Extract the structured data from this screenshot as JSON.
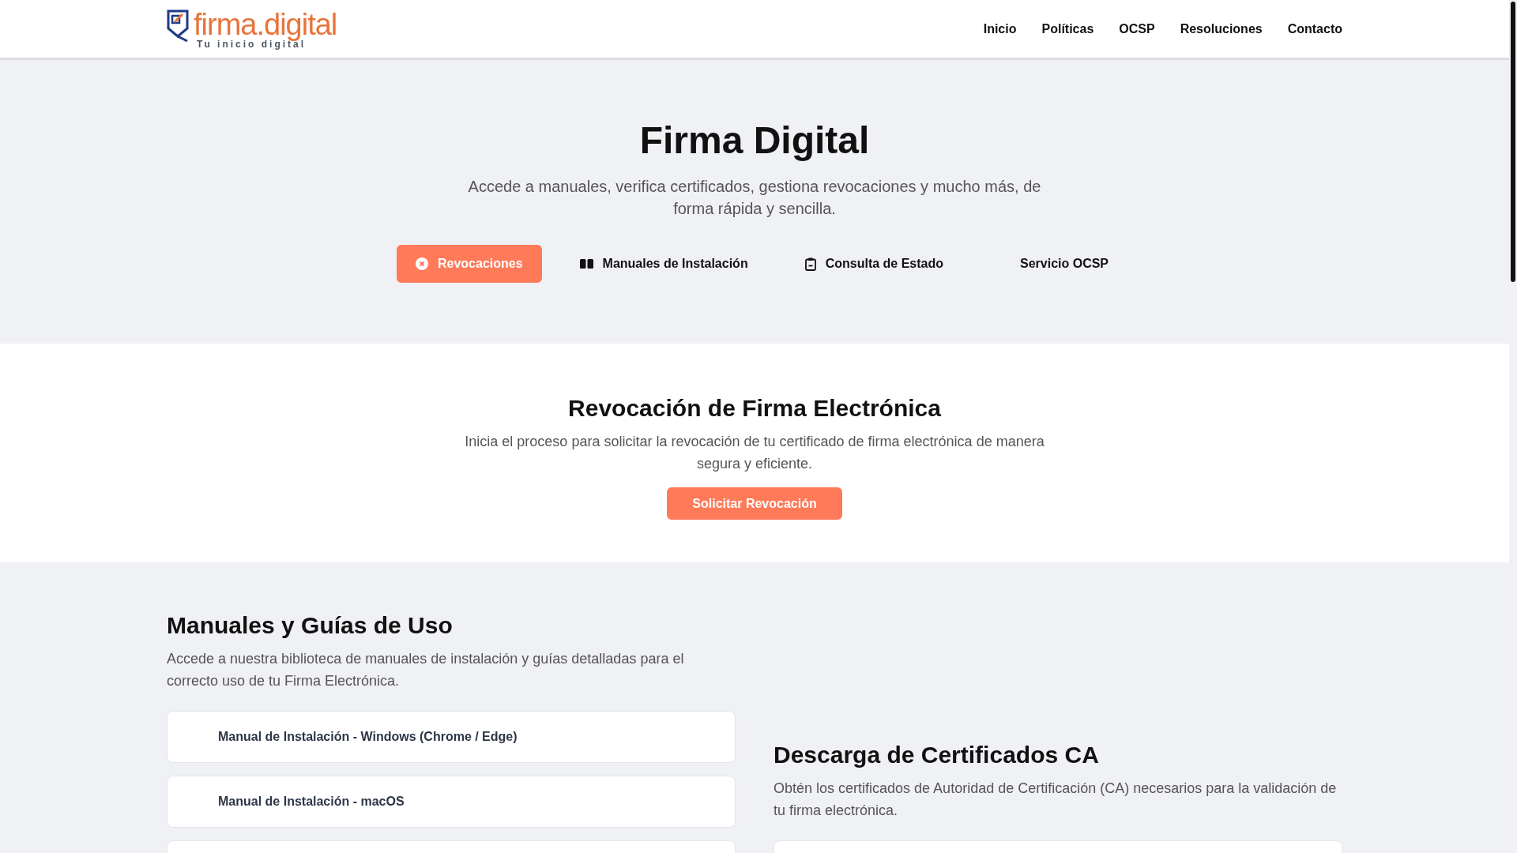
{
  "header": {
    "logo": {
      "name": "firma.digital",
      "tagline": "Tu inicio digital"
    },
    "nav": [
      {
        "label": "Inicio"
      },
      {
        "label": "Políticas"
      },
      {
        "label": "OCSP"
      },
      {
        "label": "Resoluciones"
      },
      {
        "label": "Contacto"
      }
    ]
  },
  "hero": {
    "title": "Firma Digital",
    "subtitle": "Accede a manuales, verifica certificados, gestiona revocaciones y mucho más, de forma rápida y sencilla.",
    "actions": [
      {
        "label": "Revocaciones",
        "kind": "x-circle",
        "selected": true
      },
      {
        "label": "Manuales de Instalación",
        "kind": "book",
        "selected": false
      },
      {
        "label": "Consulta de Estado",
        "kind": "clipboard",
        "selected": false
      },
      {
        "label": "Servicio OCSP",
        "kind": "plain",
        "selected": false
      }
    ]
  },
  "revocation": {
    "title": "Revocación de Firma Electrónica",
    "text": "Inicia el proceso para solicitar la revocación de tu certificado de firma electrónica de manera segura y eficiente.",
    "button": "Solicitar Revocación"
  },
  "manuals": {
    "title": "Manuales y Guías de Uso",
    "text": "Accede a nuestra biblioteca de manuales de instalación y guías detalladas para el correcto uso de tu Firma Electrónica.",
    "items": [
      {
        "kind": "manual",
        "label": "Manual de Instalación - Windows (Chrome / Edge)"
      },
      {
        "kind": "manual",
        "label": "Manual de Instalación - macOS"
      },
      {
        "kind": "blank"
      }
    ]
  },
  "certificates": {
    "title": "Descarga de Certificados CA",
    "text": "Obtén los certificados de Autoridad de Certificación (CA) necesarios para la validación de tu firma electrónica."
  }
}
